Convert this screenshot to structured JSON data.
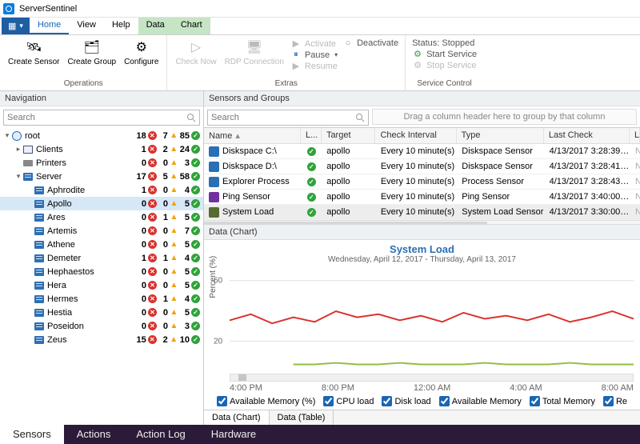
{
  "app": {
    "title": "ServerSentinel"
  },
  "menu": {
    "tabs": [
      "Home",
      "View",
      "Help",
      "Data",
      "Chart"
    ],
    "active": "Home"
  },
  "ribbon": {
    "operations": {
      "label": "Operations",
      "create_sensor": "Create\nSensor",
      "create_group": "Create\nGroup",
      "configure": "Configure"
    },
    "extras": {
      "label": "Extras",
      "check_now": "Check\nNow",
      "rdp": "RDP\nConnection",
      "activate": "Activate",
      "pause": "Pause",
      "resume": "Resume",
      "deactivate": "Deactivate"
    },
    "service": {
      "label": "Service Control",
      "status": "Status: Stopped",
      "start": "Start Service",
      "stop": "Stop Service"
    }
  },
  "nav": {
    "title": "Navigation",
    "search_placeholder": "Search",
    "tree": [
      {
        "name": "root",
        "depth": 0,
        "icon": "globe",
        "exp": "▾",
        "err": 18,
        "warn": 7,
        "ok": 85
      },
      {
        "name": "Clients",
        "depth": 1,
        "icon": "pc",
        "exp": "▸",
        "err": 1,
        "warn": 2,
        "ok": 24
      },
      {
        "name": "Printers",
        "depth": 1,
        "icon": "prn",
        "exp": "",
        "err": 0,
        "warn": 0,
        "ok": 3
      },
      {
        "name": "Server",
        "depth": 1,
        "icon": "svr",
        "exp": "▾",
        "err": 17,
        "warn": 5,
        "ok": 58
      },
      {
        "name": "Aphrodite",
        "depth": 2,
        "icon": "svr",
        "exp": "",
        "err": 1,
        "warn": 0,
        "ok": 4
      },
      {
        "name": "Apollo",
        "depth": 2,
        "icon": "svr",
        "exp": "",
        "err": 0,
        "warn": 0,
        "ok": 5,
        "sel": true
      },
      {
        "name": "Ares",
        "depth": 2,
        "icon": "svr",
        "exp": "",
        "err": 0,
        "warn": 1,
        "ok": 5
      },
      {
        "name": "Artemis",
        "depth": 2,
        "icon": "svr",
        "exp": "",
        "err": 0,
        "warn": 0,
        "ok": 7
      },
      {
        "name": "Athene",
        "depth": 2,
        "icon": "svr",
        "exp": "",
        "err": 0,
        "warn": 0,
        "ok": 5
      },
      {
        "name": "Demeter",
        "depth": 2,
        "icon": "svr",
        "exp": "",
        "err": 1,
        "warn": 1,
        "ok": 4
      },
      {
        "name": "Hephaestos",
        "depth": 2,
        "icon": "svr",
        "exp": "",
        "err": 0,
        "warn": 0,
        "ok": 5
      },
      {
        "name": "Hera",
        "depth": 2,
        "icon": "svr",
        "exp": "",
        "err": 0,
        "warn": 0,
        "ok": 5
      },
      {
        "name": "Hermes",
        "depth": 2,
        "icon": "svr",
        "exp": "",
        "err": 0,
        "warn": 1,
        "ok": 4
      },
      {
        "name": "Hestia",
        "depth": 2,
        "icon": "svr",
        "exp": "",
        "err": 0,
        "warn": 0,
        "ok": 5
      },
      {
        "name": "Poseidon",
        "depth": 2,
        "icon": "svr",
        "exp": "",
        "err": 0,
        "warn": 0,
        "ok": 3
      },
      {
        "name": "Zeus",
        "depth": 2,
        "icon": "svr",
        "exp": "",
        "err": 15,
        "warn": 2,
        "ok": 10
      }
    ]
  },
  "sensors": {
    "title": "Sensors and Groups",
    "search_placeholder": "Search",
    "groupby_hint": "Drag a column header here to group by that column",
    "columns": {
      "name": "Name",
      "l": "L...",
      "target": "Target",
      "interval": "Check Interval",
      "type": "Type",
      "last": "Last Check",
      "err": "Last Error"
    },
    "rows": [
      {
        "name": "Diskspace C:\\",
        "color": "#2a6fb3",
        "target": "apollo",
        "interval": "Every 10 minute(s)",
        "type": "Diskspace Sensor",
        "last": "4/13/2017 3:28:39…",
        "err": "N/A"
      },
      {
        "name": "Diskspace D:\\",
        "color": "#2a6fb3",
        "target": "apollo",
        "interval": "Every 10 minute(s)",
        "type": "Diskspace Sensor",
        "last": "4/13/2017 3:28:41…",
        "err": "N/A"
      },
      {
        "name": "Explorer Process",
        "color": "#2a6fb3",
        "target": "apollo",
        "interval": "Every 10 minute(s)",
        "type": "Process Sensor",
        "last": "4/13/2017 3:28:43…",
        "err": "N/A"
      },
      {
        "name": "Ping Sensor",
        "color": "#7030a0",
        "target": "apollo",
        "interval": "Every 10 minute(s)",
        "type": "Ping Sensor",
        "last": "4/13/2017 3:40:00…",
        "err": "N/A"
      },
      {
        "name": "System Load",
        "color": "#556b2f",
        "target": "apollo",
        "interval": "Every 10 minute(s)",
        "type": "System Load Sensor",
        "last": "4/13/2017 3:30:00…",
        "err": "N/A",
        "sel": true
      }
    ]
  },
  "chart_panel": {
    "title": "Data (Chart)",
    "subtabs": [
      "Data (Chart)",
      "Data (Table)"
    ]
  },
  "chart_data": {
    "type": "line",
    "title": "System Load",
    "subtitle": "Wednesday, April 12, 2017 - Thursday, April 13, 2017",
    "ylabel": "Percent (%)",
    "ylim": [
      0,
      70
    ],
    "yticks": [
      20,
      60
    ],
    "x": [
      "4:00 PM",
      "8:00 PM",
      "12:00 AM",
      "4:00 AM",
      "8:00 AM"
    ],
    "series": [
      {
        "name": "CPU load",
        "color": "#d9322e",
        "values": [
          34,
          38,
          32,
          36,
          33,
          40,
          36,
          38,
          34,
          37,
          33,
          39,
          35,
          37,
          34,
          38,
          33,
          36,
          40,
          35
        ]
      },
      {
        "name": "Disk load",
        "color": "#8fbf3f",
        "values": [
          null,
          null,
          null,
          5,
          5,
          6,
          5,
          5,
          6,
          5,
          5,
          5,
          6,
          5,
          5,
          5,
          6,
          5,
          5,
          5
        ]
      }
    ],
    "legend": [
      "Available Memory (%)",
      "CPU load",
      "Disk load",
      "Available Memory",
      "Total Memory",
      "Re"
    ]
  },
  "footer": {
    "tabs": [
      "Sensors",
      "Actions",
      "Action Log",
      "Hardware"
    ],
    "active": "Sensors"
  }
}
